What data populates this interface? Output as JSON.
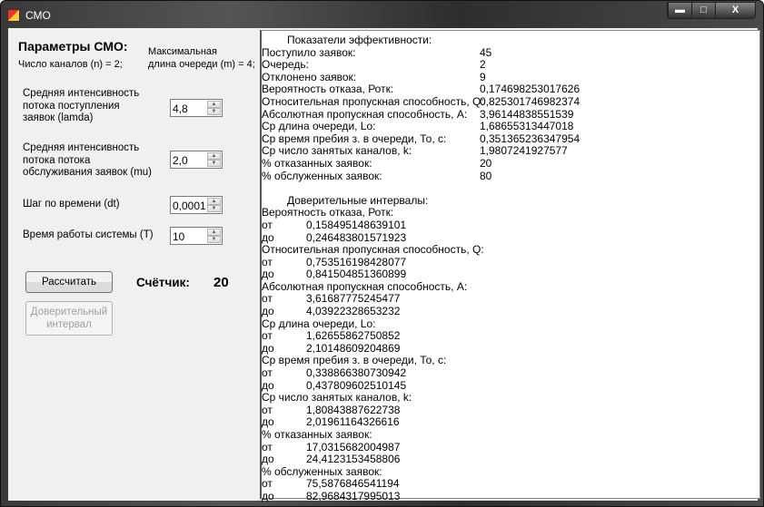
{
  "window": {
    "title": "СМО",
    "minimize": "▬",
    "maximize": "□",
    "close": "X"
  },
  "params": {
    "heading": "Параметры СМО:",
    "channels": "Число каналов (n) = 2;",
    "queue_line1": "Максимальная",
    "queue_line2": "длина очереди (m) = 4;",
    "lambda_label": [
      "Средняя интенсивность",
      "потока поступления",
      " заявок (lamda)"
    ],
    "lambda_value": "4,8",
    "mu_label": [
      "Средняя интенсивность",
      "потока потока",
      "обслуживания заявок (mu)"
    ],
    "mu_value": "2,0",
    "dt_label": "Шаг по времени (dt)",
    "dt_value": "0,0001",
    "T_label": "Время работы системы (T)",
    "T_value": "10"
  },
  "buttons": {
    "calculate": "Рассчитать",
    "interval_line1": "Доверительный",
    "interval_line2": "интервал"
  },
  "counter": {
    "label": "Счётчик:",
    "value": "20"
  },
  "results": {
    "efficiency_title": "Показатели эффективности:",
    "rows": [
      {
        "label": "Поступило заявок:",
        "value": "45"
      },
      {
        "label": "Очередь:",
        "value": "2"
      },
      {
        "label": "Отклонено заявок:",
        "value": "9"
      },
      {
        "label": "Вероятность отказа, Ротк:",
        "value": "0,174698253017626"
      },
      {
        "label": "Относительная пропускная способность, Q:",
        "value": "0,825301746982374"
      },
      {
        "label": "Абсолютная пропускная способность, А:",
        "value": "3,96144838551539"
      },
      {
        "label": "Ср длина очереди, Lo:",
        "value": "1,68655313447018"
      },
      {
        "label": "Ср время пребия з. в очереди, То, с:",
        "value": "0,351365236347954"
      },
      {
        "label": "Ср число занятых каналов, k:",
        "value": "1,9807241927577"
      },
      {
        "label": "% отказанных заявок:",
        "value": "20"
      },
      {
        "label": "% обслуженных заявок:",
        "value": "80"
      }
    ],
    "intervals_title": "Доверительные интервалы:",
    "from_label": "от",
    "to_label": "до",
    "groups": [
      {
        "label": "Вероятность отказа, Ротк:",
        "from": "0,158495148639101",
        "to": "0,246483801571923"
      },
      {
        "label": "Относительная пропускная способность, Q:",
        "from": "0,753516198428077",
        "to": "0,841504851360899"
      },
      {
        "label": "Абсолютная пропускная способность, А:",
        "from": "3,61687775245477",
        "to": "4,03922328653232"
      },
      {
        "label": "Ср длина очереди, Lo:",
        "from": "1,62655862750852",
        "to": "2,10148609204869"
      },
      {
        "label": "Ср время пребия з. в очереди, То, с:",
        "from": "0,338866380730942",
        "to": "0,437809602510145"
      },
      {
        "label": "Ср число занятых каналов, k:",
        "from": "1,80843887622738",
        "to": "2,01961164326616"
      },
      {
        "label": "% отказанных заявок:",
        "from": "17,0315682004987",
        "to": "24,4123153458806"
      },
      {
        "label": "% обслуженных заявок:",
        "from": "75,5876846541194",
        "to": "82,9684317995013"
      }
    ]
  }
}
